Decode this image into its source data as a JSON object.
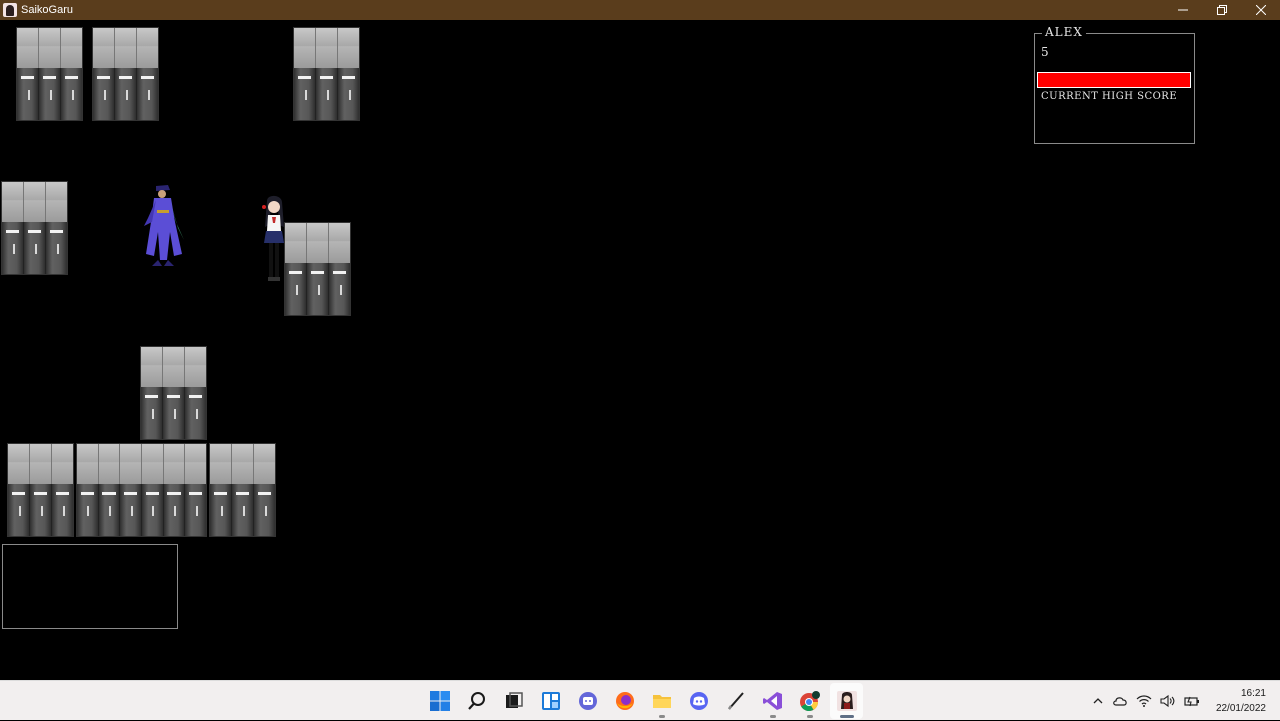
{
  "window": {
    "title": "SaikoGaru",
    "minimize_glyph": "—",
    "restore_glyph": "❐",
    "close_glyph": "✕"
  },
  "hud": {
    "player_name": "ALEX",
    "score": "5",
    "health_fraction": 1.0,
    "health_color": "#ff0000",
    "high_score_label": "CURRENT HIGH SCORE"
  },
  "taskbar": {
    "apps": [
      {
        "name": "start-button",
        "icon": "windows-logo-icon"
      },
      {
        "name": "search-button",
        "icon": "search-icon"
      },
      {
        "name": "task-view-button",
        "icon": "task-view-icon"
      },
      {
        "name": "widgets-button",
        "icon": "widgets-icon"
      },
      {
        "name": "teams-chat-button",
        "icon": "chat-icon"
      },
      {
        "name": "firefox-button",
        "icon": "firefox-icon"
      },
      {
        "name": "file-explorer-button",
        "icon": "folder-icon"
      },
      {
        "name": "discord-button",
        "icon": "discord-icon"
      },
      {
        "name": "pen-app-button",
        "icon": "pen-icon"
      },
      {
        "name": "visual-studio-button",
        "icon": "visual-studio-icon"
      },
      {
        "name": "chrome-button",
        "icon": "chrome-icon"
      },
      {
        "name": "saikogaru-button",
        "icon": "saikogaru-icon"
      }
    ],
    "time": "16:21",
    "date": "22/01/2022"
  },
  "colors": {
    "titlebar": "#5a3d1c",
    "taskbar": "#f2efef",
    "game_background": "#000000"
  }
}
